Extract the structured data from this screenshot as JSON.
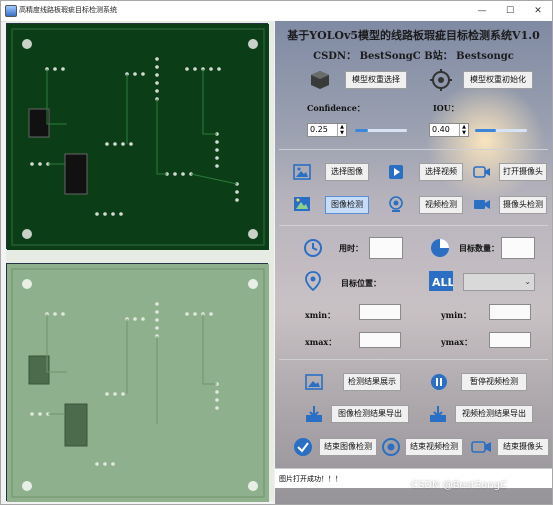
{
  "window": {
    "title": "高精度线路板瑕疵目标检测系统"
  },
  "header": {
    "title": "基于YOLOv5模型的线路板瑕疵目标检测系统V1.0",
    "subtitle": "CSDN：  BestSongC    B站：  Bestsongc"
  },
  "model": {
    "select_label": "模型权重选择",
    "init_label": "模型权重初始化"
  },
  "params": {
    "confidence_label": "Confidence：",
    "confidence_value": "0.25",
    "confidence_fraction": 0.25,
    "iou_label": "IOU：",
    "iou_value": "0.40",
    "iou_fraction": 0.4
  },
  "actions": {
    "select_image": "选择图像",
    "select_video": "选择视频",
    "open_camera": "打开摄像头",
    "image_detect": "图像检测",
    "video_detect": "视频检测",
    "camera_detect": "摄像头检测"
  },
  "info": {
    "time_label": "用时：",
    "target_count_label": "目标数量：",
    "target_position_label": "目标位置：",
    "xmin_label": "xmin：",
    "ymin_label": "ymin：",
    "xmax_label": "xmax：",
    "ymax_label": "ymax："
  },
  "results": {
    "show_results": "检测结果展示",
    "pause_video": "暂停视频检测",
    "export_image": "图像检测结果导出",
    "export_video": "视频检测结果导出",
    "end_image": "结束图像检测",
    "end_video": "结束视频检测",
    "end_camera": "结束摄像头"
  },
  "status": {
    "message": "图片打开成功！！！"
  },
  "watermark": "CSDN @BestSongC",
  "colors": {
    "accent": "#3b86d9",
    "pcb_dark": "#0b3d16",
    "pcb_light": "#8fb08c"
  }
}
